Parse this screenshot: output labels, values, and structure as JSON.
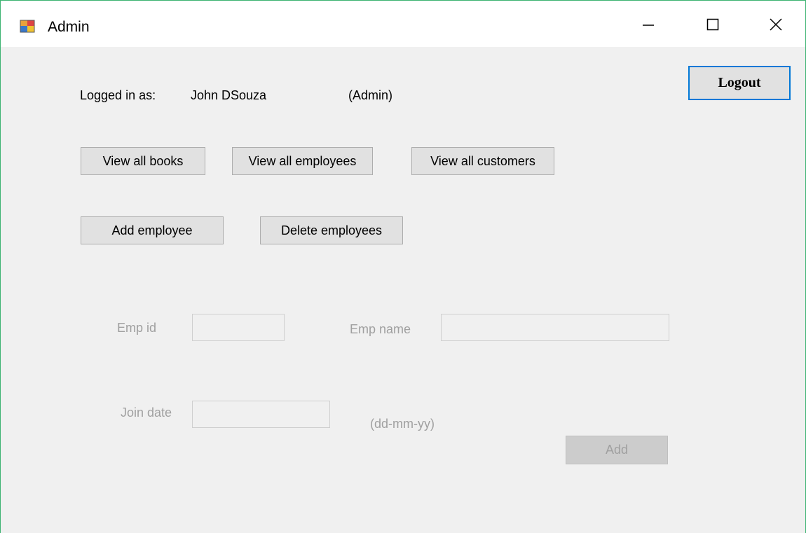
{
  "window": {
    "title": "Admin"
  },
  "user": {
    "logged_in_label": "Logged in as:",
    "name": "John DSouza",
    "role": "(Admin)"
  },
  "buttons": {
    "logout": "Logout",
    "view_books": "View all books",
    "view_employees": "View all employees",
    "view_customers": "View all customers",
    "add_employee": "Add employee",
    "delete_employees": "Delete employees",
    "add": "Add"
  },
  "form": {
    "emp_id_label": "Emp id",
    "emp_id_value": "",
    "emp_name_label": "Emp name",
    "emp_name_value": "",
    "join_date_label": "Join date",
    "join_date_value": "",
    "date_format_hint": "(dd-mm-yy)"
  },
  "icons": {
    "app": "app-form-icon",
    "minimize": "minimize-icon",
    "maximize": "maximize-icon",
    "close": "close-icon"
  },
  "colors": {
    "focus_border": "#0078d7",
    "window_border": "#3cb371",
    "dialog_bg": "#f0f0f0"
  }
}
